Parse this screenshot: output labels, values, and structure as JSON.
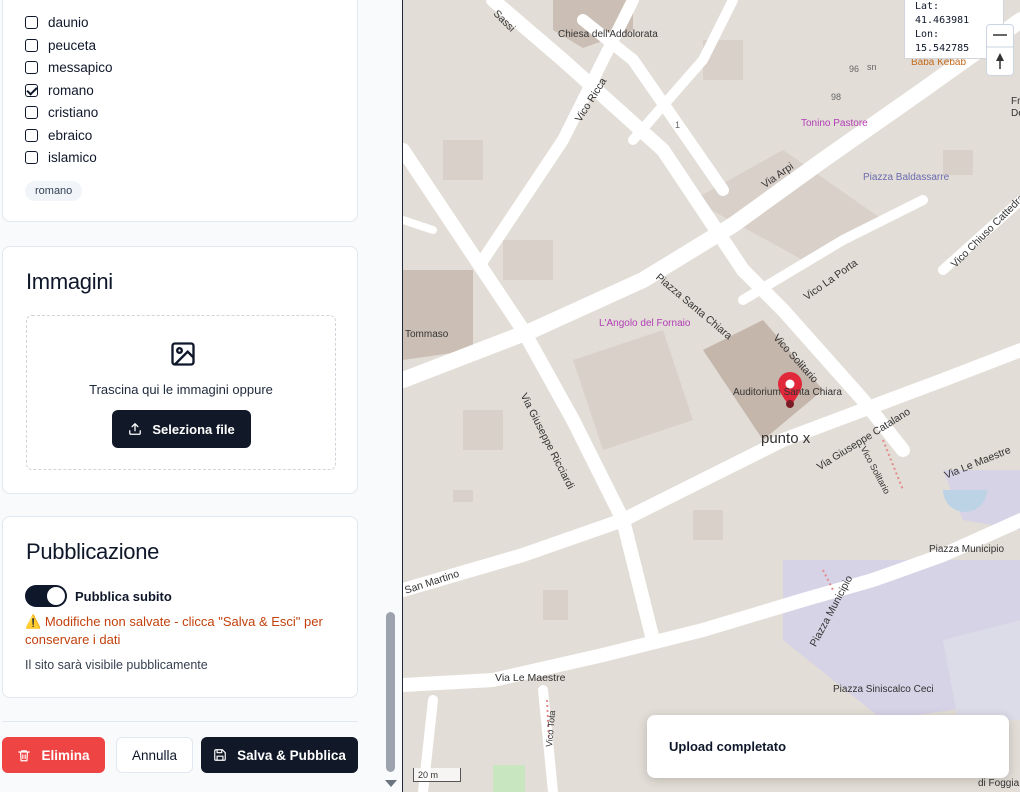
{
  "religion": {
    "options": [
      {
        "label": "daunio",
        "checked": false
      },
      {
        "label": "peuceta",
        "checked": false
      },
      {
        "label": "messapico",
        "checked": false
      },
      {
        "label": "romano",
        "checked": true
      },
      {
        "label": "cristiano",
        "checked": false
      },
      {
        "label": "ebraico",
        "checked": false
      },
      {
        "label": "islamico",
        "checked": false
      }
    ],
    "selected_chip": "romano"
  },
  "images": {
    "title": "Immagini",
    "drop_text": "Trascina qui le immagini oppure",
    "select_button": "Seleziona file"
  },
  "publish": {
    "title": "Pubblicazione",
    "toggle_label": "Pubblica subito",
    "toggle_on": true,
    "warning_text": "Modifiche non salvate - clicca \"Salva & Esci\" per conservare i dati",
    "note": "Il sito sarà visibile pubblicamente"
  },
  "actions": {
    "delete": "Elimina",
    "cancel": "Annulla",
    "save_publish": "Salva & Pubblica"
  },
  "map": {
    "lat_line": "Lat: 41.463981",
    "lon_line": "Lon: 15.542785",
    "marker_label": "punto x",
    "scale": "20 m",
    "toast": "Upload completato",
    "labels": {
      "chiesa": "Chiesa dell'Addolorata",
      "tonino": "Tonino Pastore",
      "baba": "Baba Kebab",
      "baldassarre": "Piazza Baldassarre",
      "angolo": "L'Angolo del Fornaio",
      "auditorium": "Auditorium Santa Chiara",
      "tommaso": "Tommaso",
      "municipio": "Piazza Municipio",
      "siniscalco": "Piazza Siniscalco Ceci",
      "foggia": "di Foggia",
      "fr": "Fr",
      "de": "De"
    },
    "streets": {
      "sassi": "Sassi",
      "vico_ricca": "Vico Ricca",
      "via_arpi": "Via Arpi",
      "piazza_santa_chiara": "Piazza Santa Chiara",
      "vico_la_porta": "Vico La Porta",
      "vico_chiuso_cattedrale": "Vico Chiuso Cattedrale",
      "vico_solitario": "Vico Solitario",
      "vico_solitario_2": "Vico Solitario",
      "via_giuseppe_catalano": "Via Giuseppe Catalano",
      "via_giuseppe_ricciardi": "Via Giuseppe Ricciardi",
      "via_le_maestre": "Via Le Maestre",
      "via_le_maestre_2": "Via Le Maestre",
      "san_martino": "San Martino",
      "piazza_municipio": "Piazza Municipio",
      "vico_tota": "Vico Tota"
    },
    "house_numbers": [
      "96",
      "98",
      "1",
      "sn"
    ]
  }
}
